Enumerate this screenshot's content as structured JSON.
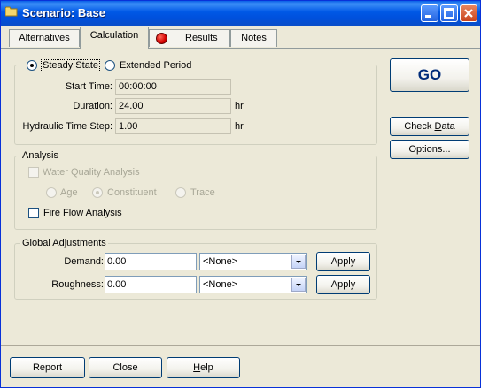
{
  "window": {
    "title": "Scenario: Base"
  },
  "titlebar": {
    "icons": [
      "folder-icon",
      "minimize-icon",
      "maximize-icon",
      "close-icon"
    ]
  },
  "tabs": [
    {
      "label": "Alternatives"
    },
    {
      "label": "Calculation",
      "active": true
    },
    {
      "label": "Results",
      "icon": "red-status-dot-icon"
    },
    {
      "label": "Notes"
    }
  ],
  "calculation": {
    "mode": {
      "steady_state": "Steady State",
      "extended_period": "Extended Period",
      "selected": "Steady State"
    },
    "start_time": {
      "label": "Start Time:",
      "value": "00:00:00"
    },
    "duration": {
      "label": "Duration:",
      "value": "24.00",
      "unit": "hr"
    },
    "hydraulic_time_step": {
      "label": "Hydraulic Time Step:",
      "value": "1.00",
      "unit": "hr"
    }
  },
  "analysis": {
    "title": "Analysis",
    "water_quality": {
      "label": "Water Quality Analysis",
      "checked": false,
      "enabled": false
    },
    "wq_options": {
      "age": "Age",
      "constituent": "Constituent",
      "trace": "Trace",
      "selected": "Constituent"
    },
    "fire_flow": {
      "label": "Fire Flow Analysis",
      "checked": false
    }
  },
  "global_adjustments": {
    "title": "Global Adjustments",
    "demand": {
      "label": "Demand:",
      "value": "0.00",
      "option": "<None>",
      "apply": "Apply"
    },
    "roughness": {
      "label": "Roughness:",
      "value": "0.00",
      "option": "<None>",
      "apply": "Apply"
    }
  },
  "side_buttons": {
    "go": "GO",
    "check_data_pre": "Check ",
    "check_data_ul": "D",
    "check_data_post": "ata",
    "options": "Options..."
  },
  "footer": {
    "report": "Report",
    "close": "Close",
    "help_ul": "H",
    "help_post": "elp"
  }
}
